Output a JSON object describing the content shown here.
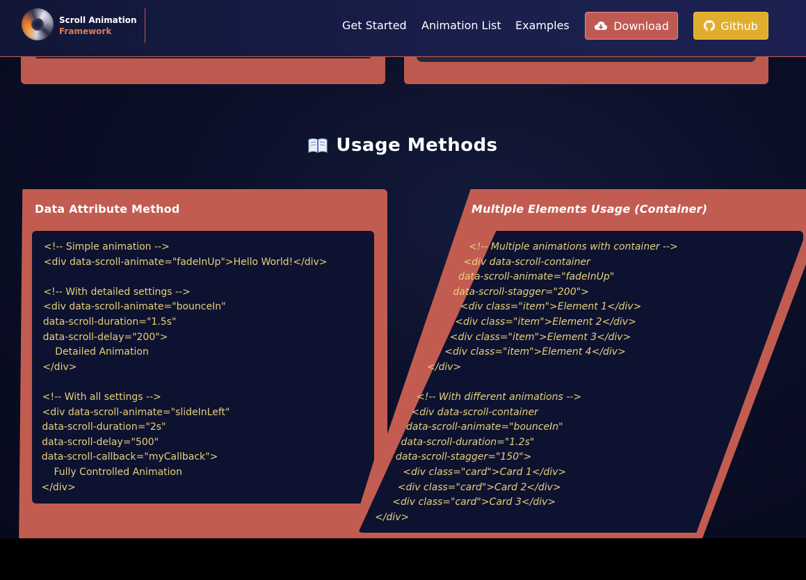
{
  "header": {
    "brand_top": "Scroll Animation",
    "brand_bottom": "Framework",
    "nav": [
      "Get Started",
      "Animation List",
      "Examples"
    ],
    "download_label": "Download",
    "github_label": "Github"
  },
  "section": {
    "title": "Usage Methods"
  },
  "left_card": {
    "title": "Data Attribute Method",
    "code": [
      "<!-- Simple animation -->",
      "<div data-scroll-animate=\"fadeInUp\">Hello World!</div>",
      "",
      "<!-- With detailed settings -->",
      "<div data-scroll-animate=\"bounceIn\"",
      "data-scroll-duration=\"1.5s\"",
      "data-scroll-delay=\"200\">",
      "    Detailed Animation",
      "</div>",
      "",
      "<!-- With all settings -->",
      "<div data-scroll-animate=\"slideInLeft\"",
      "data-scroll-duration=\"2s\"",
      "data-scroll-delay=\"500\"",
      "data-scroll-callback=\"myCallback\">",
      "    Fully Controlled Animation",
      "</div>"
    ]
  },
  "right_card": {
    "title": "Multiple Elements Usage (Container)",
    "code": [
      "<!-- Multiple animations with container -->",
      "<div data-scroll-container",
      "data-scroll-animate=\"fadeInUp\"",
      "data-scroll-stagger=\"200\">",
      "    <div class=\"item\">Element 1</div>",
      "    <div class=\"item\">Element 2</div>",
      "    <div class=\"item\">Element 3</div>",
      "    <div class=\"item\">Element 4</div>",
      "</div>",
      "",
      "<!-- With different animations -->",
      "<div data-scroll-container",
      "data-scroll-animate=\"bounceIn\"",
      "data-scroll-duration=\"1.2s\"",
      "data-scroll-stagger=\"150\">",
      "    <div class=\"card\">Card 1</div>",
      "    <div class=\"card\">Card 2</div>",
      "    <div class=\"card\">Card 3</div>",
      "</div>"
    ]
  },
  "colors": {
    "card": "#c25c51",
    "code_bg": "#0d1230",
    "code_text": "#e7d07c",
    "brand_accent": "#e07a52",
    "github_button": "#e1ad2d",
    "download_button": "#bf5a53"
  },
  "icons": {
    "download": "cloud-download-icon",
    "github": "github-icon",
    "section": "open-book-icon"
  }
}
